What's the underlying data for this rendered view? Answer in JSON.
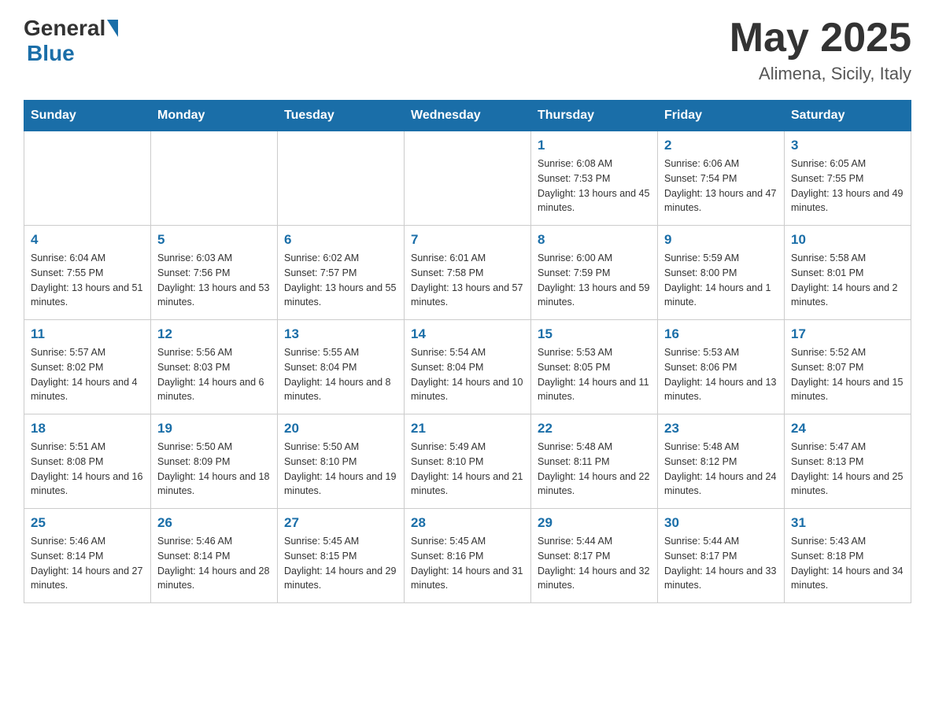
{
  "logo": {
    "general": "General",
    "blue": "Blue"
  },
  "title": {
    "month": "May 2025",
    "location": "Alimena, Sicily, Italy"
  },
  "weekdays": [
    "Sunday",
    "Monday",
    "Tuesday",
    "Wednesday",
    "Thursday",
    "Friday",
    "Saturday"
  ],
  "weeks": [
    [
      {
        "day": "",
        "info": ""
      },
      {
        "day": "",
        "info": ""
      },
      {
        "day": "",
        "info": ""
      },
      {
        "day": "",
        "info": ""
      },
      {
        "day": "1",
        "info": "Sunrise: 6:08 AM\nSunset: 7:53 PM\nDaylight: 13 hours and 45 minutes."
      },
      {
        "day": "2",
        "info": "Sunrise: 6:06 AM\nSunset: 7:54 PM\nDaylight: 13 hours and 47 minutes."
      },
      {
        "day": "3",
        "info": "Sunrise: 6:05 AM\nSunset: 7:55 PM\nDaylight: 13 hours and 49 minutes."
      }
    ],
    [
      {
        "day": "4",
        "info": "Sunrise: 6:04 AM\nSunset: 7:55 PM\nDaylight: 13 hours and 51 minutes."
      },
      {
        "day": "5",
        "info": "Sunrise: 6:03 AM\nSunset: 7:56 PM\nDaylight: 13 hours and 53 minutes."
      },
      {
        "day": "6",
        "info": "Sunrise: 6:02 AM\nSunset: 7:57 PM\nDaylight: 13 hours and 55 minutes."
      },
      {
        "day": "7",
        "info": "Sunrise: 6:01 AM\nSunset: 7:58 PM\nDaylight: 13 hours and 57 minutes."
      },
      {
        "day": "8",
        "info": "Sunrise: 6:00 AM\nSunset: 7:59 PM\nDaylight: 13 hours and 59 minutes."
      },
      {
        "day": "9",
        "info": "Sunrise: 5:59 AM\nSunset: 8:00 PM\nDaylight: 14 hours and 1 minute."
      },
      {
        "day": "10",
        "info": "Sunrise: 5:58 AM\nSunset: 8:01 PM\nDaylight: 14 hours and 2 minutes."
      }
    ],
    [
      {
        "day": "11",
        "info": "Sunrise: 5:57 AM\nSunset: 8:02 PM\nDaylight: 14 hours and 4 minutes."
      },
      {
        "day": "12",
        "info": "Sunrise: 5:56 AM\nSunset: 8:03 PM\nDaylight: 14 hours and 6 minutes."
      },
      {
        "day": "13",
        "info": "Sunrise: 5:55 AM\nSunset: 8:04 PM\nDaylight: 14 hours and 8 minutes."
      },
      {
        "day": "14",
        "info": "Sunrise: 5:54 AM\nSunset: 8:04 PM\nDaylight: 14 hours and 10 minutes."
      },
      {
        "day": "15",
        "info": "Sunrise: 5:53 AM\nSunset: 8:05 PM\nDaylight: 14 hours and 11 minutes."
      },
      {
        "day": "16",
        "info": "Sunrise: 5:53 AM\nSunset: 8:06 PM\nDaylight: 14 hours and 13 minutes."
      },
      {
        "day": "17",
        "info": "Sunrise: 5:52 AM\nSunset: 8:07 PM\nDaylight: 14 hours and 15 minutes."
      }
    ],
    [
      {
        "day": "18",
        "info": "Sunrise: 5:51 AM\nSunset: 8:08 PM\nDaylight: 14 hours and 16 minutes."
      },
      {
        "day": "19",
        "info": "Sunrise: 5:50 AM\nSunset: 8:09 PM\nDaylight: 14 hours and 18 minutes."
      },
      {
        "day": "20",
        "info": "Sunrise: 5:50 AM\nSunset: 8:10 PM\nDaylight: 14 hours and 19 minutes."
      },
      {
        "day": "21",
        "info": "Sunrise: 5:49 AM\nSunset: 8:10 PM\nDaylight: 14 hours and 21 minutes."
      },
      {
        "day": "22",
        "info": "Sunrise: 5:48 AM\nSunset: 8:11 PM\nDaylight: 14 hours and 22 minutes."
      },
      {
        "day": "23",
        "info": "Sunrise: 5:48 AM\nSunset: 8:12 PM\nDaylight: 14 hours and 24 minutes."
      },
      {
        "day": "24",
        "info": "Sunrise: 5:47 AM\nSunset: 8:13 PM\nDaylight: 14 hours and 25 minutes."
      }
    ],
    [
      {
        "day": "25",
        "info": "Sunrise: 5:46 AM\nSunset: 8:14 PM\nDaylight: 14 hours and 27 minutes."
      },
      {
        "day": "26",
        "info": "Sunrise: 5:46 AM\nSunset: 8:14 PM\nDaylight: 14 hours and 28 minutes."
      },
      {
        "day": "27",
        "info": "Sunrise: 5:45 AM\nSunset: 8:15 PM\nDaylight: 14 hours and 29 minutes."
      },
      {
        "day": "28",
        "info": "Sunrise: 5:45 AM\nSunset: 8:16 PM\nDaylight: 14 hours and 31 minutes."
      },
      {
        "day": "29",
        "info": "Sunrise: 5:44 AM\nSunset: 8:17 PM\nDaylight: 14 hours and 32 minutes."
      },
      {
        "day": "30",
        "info": "Sunrise: 5:44 AM\nSunset: 8:17 PM\nDaylight: 14 hours and 33 minutes."
      },
      {
        "day": "31",
        "info": "Sunrise: 5:43 AM\nSunset: 8:18 PM\nDaylight: 14 hours and 34 minutes."
      }
    ]
  ]
}
